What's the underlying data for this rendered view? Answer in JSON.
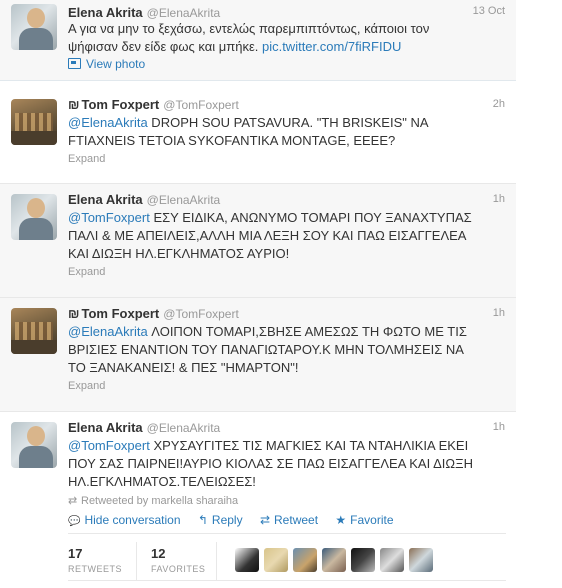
{
  "tweets": [
    {
      "name": "Elena Akrita",
      "handle": "@ElenaAkrita",
      "time": "13 Oct",
      "text_line1": "Α για να μην το ξεχάσω, εντελώς παρεμπιπτόντως, κάποιοι τον",
      "text_line2_plain": "ψήφισαν δεν είδε φως και μπήκε. ",
      "text_line2_link": "pic.twitter.com/7fiRFIDU",
      "view_photo": "View photo"
    },
    {
      "name": "Tom Foxpert",
      "handle": "@TomFoxpert",
      "time": "2h",
      "mention": "@ElenaAkrita",
      "text_line1_rest": " DROPH SOU PATSAVURA. \"TH BRISKEIS\" NA",
      "text_line2": "FTIAXNEIS TETOIA SYKOFANTIKA MONTAGE, EEEE?",
      "expand": "Expand"
    },
    {
      "name": "Elena Akrita",
      "handle": "@ElenaAkrita",
      "time": "1h",
      "mention": "@TomFoxpert",
      "text_line1_rest": " ΕΣΥ ΕΙΔΙΚΑ, ΑΝΩΝΥΜΟ ΤΟΜΑΡΙ ΠΟΥ ΞΑΝΑΧΤΥΠΑΣ",
      "text_line2": "ΠΑΛΙ & ΜΕ ΑΠΕΙΛΕΙΣ,ΑΛΛΗ ΜΙΑ ΛΕΞΗ ΣΟΥ ΚΑΙ ΠΑΩ ΕΙΣΑΓΓΕΛΕΑ",
      "text_line3": "ΚΑΙ ΔΙΩΞΗ ΗΛ.ΕΓΚΛΗΜΑΤΟΣ ΑΥΡΙΟ!",
      "expand": "Expand"
    },
    {
      "name": "Tom Foxpert",
      "handle": "@TomFoxpert",
      "time": "1h",
      "mention": "@ElenaAkrita",
      "text_line1_rest": " ΛΟΙΠΟΝ ΤΟΜΑΡΙ,ΣΒΗΣΕ ΑΜΕΣΩΣ ΤΗ ΦΩΤΟ ΜΕ ΤΙΣ",
      "text_line2": "ΒΡΙΣΙΕΣ ΕΝΑΝΤΙΟΝ ΤΟΥ ΠΑΝΑΓΙΩΤΑΡΟΥ.Κ ΜΗΝ ΤΟΛΜΗΣΕΙΣ ΝΑ",
      "text_line3": "ΤΟ ΞΑΝΑΚΑΝΕΙΣ! & ΠΕΣ \"ΗΜΑΡΤΟΝ\"!",
      "expand": "Expand"
    },
    {
      "name": "Elena Akrita",
      "handle": "@ElenaAkrita",
      "time": "1h",
      "mention": "@TomFoxpert",
      "text_line1_rest": " ΧΡΥΣΑΥΓΙΤΕΣ ΤΙΣ ΜΑΓΚΙΕΣ ΚΑΙ ΤΑ ΝΤΑΗΛΙΚΙΑ ΕΚΕΙ",
      "text_line2": "ΠΟΥ ΣΑΣ ΠΑΙΡΝΕΙ!ΑΥΡΙΟ ΚΙΟΛΑΣ ΣΕ ΠΑΩ ΕΙΣΑΓΓΕΛΕΑ ΚΑΙ ΔΙΩΞΗ",
      "text_line3": "ΗΛ.ΕΓΚΛΗΜΑΤΟΣ.ΤΕΛΕΙΩΣΕΣ!",
      "retweeted_by": "Retweeted by markella sharaiha",
      "actions": {
        "hide": "Hide conversation",
        "reply": "Reply",
        "retweet": "Retweet",
        "favorite": "Favorite"
      },
      "stats": {
        "retweets_count": "17",
        "retweets_label": "RETWEETS",
        "favorites_count": "12",
        "favorites_label": "FAVORITES"
      }
    }
  ],
  "icons": {
    "retweeted_glyph": "⇄",
    "hide_glyph": "💬",
    "reply_glyph": "↰",
    "retweet_glyph": "⇄",
    "favorite_glyph": "★",
    "protected_glyph": "₪"
  },
  "colors": {
    "link": "#2b7bb9",
    "muted": "#999999",
    "highlight_bg": "#f7f7f7"
  }
}
